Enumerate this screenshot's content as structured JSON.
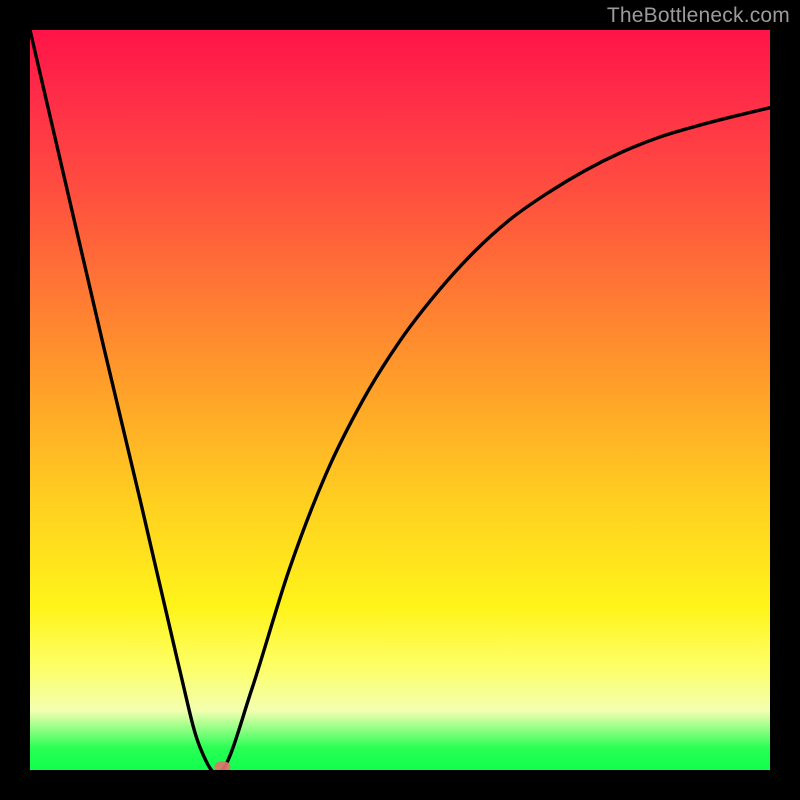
{
  "watermark": "TheBottleneck.com",
  "chart_data": {
    "type": "line",
    "title": "",
    "xlabel": "",
    "ylabel": "",
    "xlim": [
      0,
      100
    ],
    "ylim": [
      0,
      100
    ],
    "grid": false,
    "series": [
      {
        "name": "curve",
        "x": [
          0,
          5,
          10,
          15,
          20,
          23,
          26,
          30,
          35,
          40,
          45,
          50,
          55,
          60,
          65,
          70,
          75,
          80,
          85,
          90,
          95,
          100
        ],
        "y": [
          100,
          78.5,
          57,
          36,
          14.5,
          3,
          0,
          11,
          27,
          40,
          50,
          58,
          64.5,
          70,
          74.5,
          78,
          81,
          83.5,
          85.5,
          87,
          88.3,
          89.5
        ]
      }
    ],
    "marker": {
      "x": 26,
      "y": 0,
      "color": "#e0756c"
    },
    "colors": {
      "curve": "#000000",
      "background_gradient": [
        "#ff1447",
        "#ffa528",
        "#fff41a",
        "#0fff4e"
      ]
    }
  }
}
